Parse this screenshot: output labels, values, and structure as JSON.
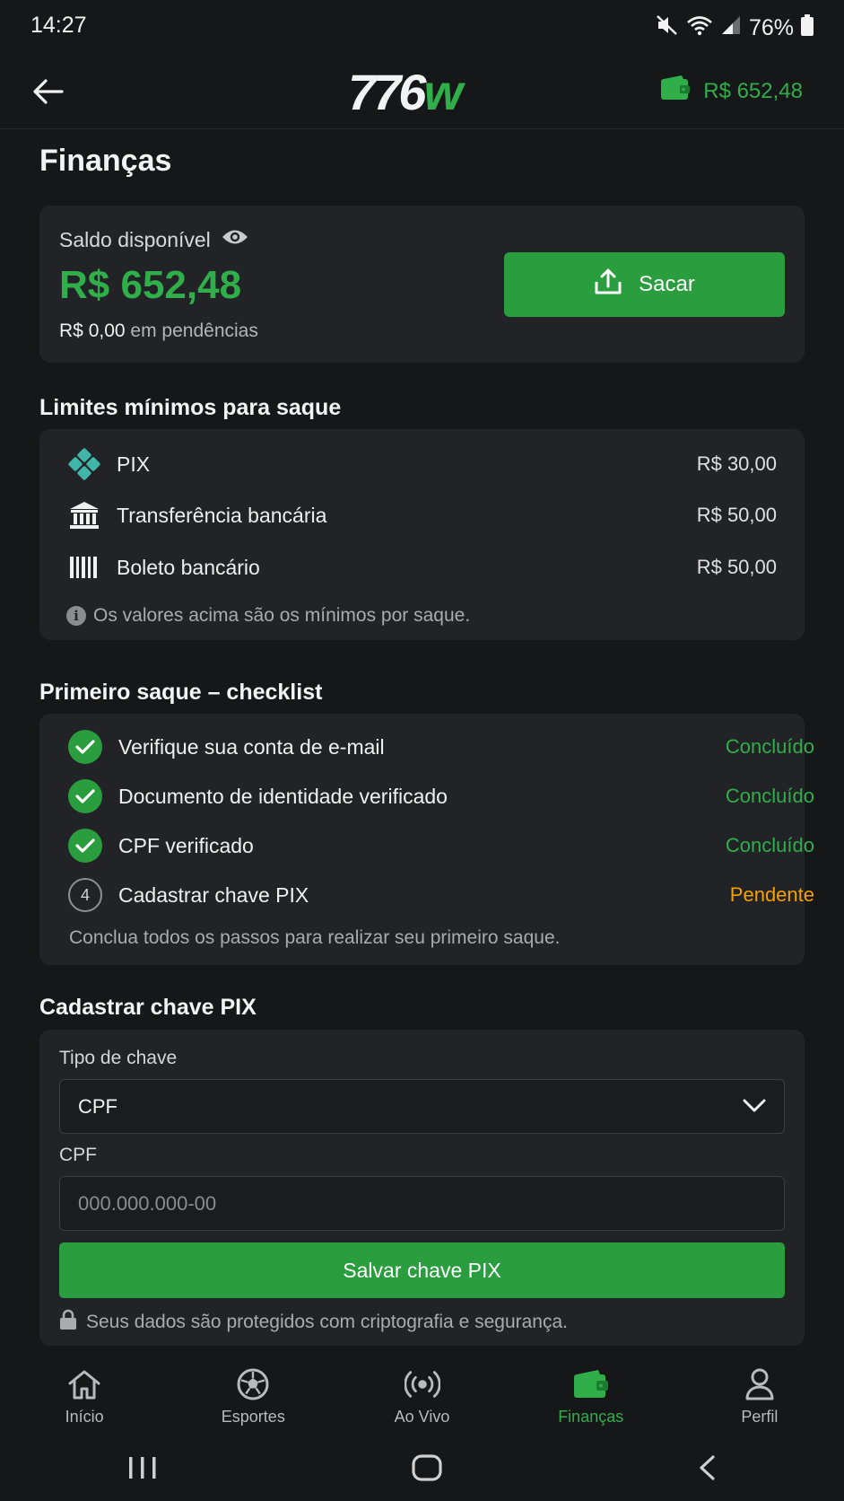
{
  "status_bar": {
    "time": "14:27",
    "battery": "76%"
  },
  "header": {
    "logo_main": "776",
    "logo_accent": "w",
    "balance": "R$ 652,48"
  },
  "page": {
    "title": "Finanças"
  },
  "balance_card": {
    "label": "Saldo disponível",
    "value": "R$ 652,48",
    "pending_prefix": "R$",
    "pending_amount": "0,00",
    "pending_suffix": "em pendências",
    "withdraw_label": "Sacar"
  },
  "limits": {
    "title": "Limites mínimos para saque",
    "items": [
      {
        "icon": "pix-icon",
        "name": "PIX",
        "value": "R$ 30,00"
      },
      {
        "icon": "bank-icon",
        "name": "Transferência bancária",
        "value": "R$ 50,00"
      },
      {
        "icon": "barcode-icon",
        "name": "Boleto bancário",
        "value": "R$ 50,00"
      }
    ],
    "note": "Os valores acima são os mínimos por saque."
  },
  "checklist": {
    "title": "Primeiro saque – checklist",
    "items": [
      {
        "label": "Verifique sua conta de e-mail",
        "status": "Concluído",
        "done": true
      },
      {
        "label": "Documento de identidade verificado",
        "status": "Concluído",
        "done": true
      },
      {
        "label": "CPF verificado",
        "status": "Concluído",
        "done": true
      },
      {
        "step": "4",
        "label": "Cadastrar chave PIX",
        "status": "Pendente",
        "done": false
      }
    ],
    "note": "Conclua todos os passos para realizar seu primeiro saque."
  },
  "pix_form": {
    "title": "Cadastrar chave PIX",
    "key_type_label": "Tipo de chave",
    "key_type_value": "CPF",
    "cpf_label": "CPF",
    "cpf_placeholder": "000.000.000-00",
    "save_label": "Salvar chave PIX",
    "secure_note": "Seus dados são protegidos com criptografia e segurança."
  },
  "bottom_nav": [
    {
      "label": "Início",
      "icon": "home-icon",
      "active": false
    },
    {
      "label": "Esportes",
      "icon": "soccer-ball-icon",
      "active": false
    },
    {
      "label": "Ao Vivo",
      "icon": "live-broadcast-icon",
      "active": false
    },
    {
      "label": "Finanças",
      "icon": "wallet-icon",
      "active": true
    },
    {
      "label": "Perfil",
      "icon": "user-icon",
      "active": false
    }
  ],
  "colors": {
    "accent": "#2fae4a",
    "button": "#2a9d3e",
    "pending": "#f5a000",
    "card": "#222326",
    "background": "#161719"
  }
}
